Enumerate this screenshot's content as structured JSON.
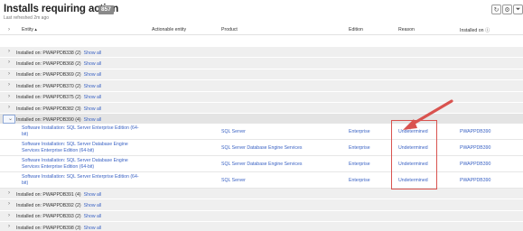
{
  "header": {
    "title": "Installs requiring action",
    "count_badge": "857",
    "subtitle": "Last refreshed 2m ago",
    "buttons": [
      {
        "name": "refresh-button",
        "icon": "refresh-icon",
        "glyph": "↻"
      },
      {
        "name": "settings-button",
        "icon": "gear-icon",
        "glyph": "⚙"
      },
      {
        "name": "filter-button",
        "icon": "filter-icon",
        "glyph": "⏷"
      }
    ]
  },
  "columns": {
    "entity": "Entity ▴",
    "actionable_entity": "Actionable entity",
    "product": "Product",
    "edition": "Edition",
    "reason": "Reason",
    "installed_on": "Installed on ⓘ"
  },
  "groups_before": [
    {
      "label": "Installed on: PWAPPDB338 (2)",
      "show": "Show all"
    },
    {
      "label": "Installed on: PWAPPDB368 (2)",
      "show": "Show all"
    },
    {
      "label": "Installed on: PWAPPDB369 (2)",
      "show": "Show all"
    },
    {
      "label": "Installed on: PWAPPDB370 (2)",
      "show": "Show all"
    },
    {
      "label": "Installed on: PWAPPDB375 (2)",
      "show": "Show all"
    },
    {
      "label": "Installed on: PWAPPDB382 (3)",
      "show": "Show all"
    },
    {
      "label": "Installed on: PWAPPDB389 (3)",
      "show": "Show all"
    }
  ],
  "expanded_group": {
    "label": "Installed on: PWAPPDB390 (4)",
    "show": "Show all"
  },
  "expanded_rows": [
    {
      "entity": "Software Installation: SQL Server Enterprise Edition (64-bit)",
      "product": "SQL Server",
      "edition": "Enterprise",
      "reason": "Undetermined",
      "installed_on": "PWAPPDB390"
    },
    {
      "entity": "Software Installation: SQL Server Database Engine Services Enterprise Edition (64-bit)",
      "product": "SQL Server Database Engine Services",
      "edition": "Enterprise",
      "reason": "Undetermined",
      "installed_on": "PWAPPDB390"
    },
    {
      "entity": "Software Installation: SQL Server Database Engine Services Enterprise Edition (64-bit)",
      "product": "SQL Server Database Engine Services",
      "edition": "Enterprise",
      "reason": "Undetermined",
      "installed_on": "PWAPPDB390"
    },
    {
      "entity": "Software Installation: SQL Server Enterprise Edition (64-bit)",
      "product": "SQL Server",
      "edition": "Enterprise",
      "reason": "Undetermined",
      "installed_on": "PWAPPDB390"
    }
  ],
  "groups_after": [
    {
      "label": "Installed on: PWAPPDB391 (4)",
      "show": "Show all"
    },
    {
      "label": "Installed on: PWAPPDB392 (2)",
      "show": "Show all"
    },
    {
      "label": "Installed on: PWAPPDB393 (2)",
      "show": "Show all"
    },
    {
      "label": "Installed on: PWAPPDB398 (3)",
      "show": "Show all"
    }
  ],
  "colors": {
    "link": "#3b63c4",
    "annotation": "#d9534f",
    "badge": "#8a8a8a"
  }
}
